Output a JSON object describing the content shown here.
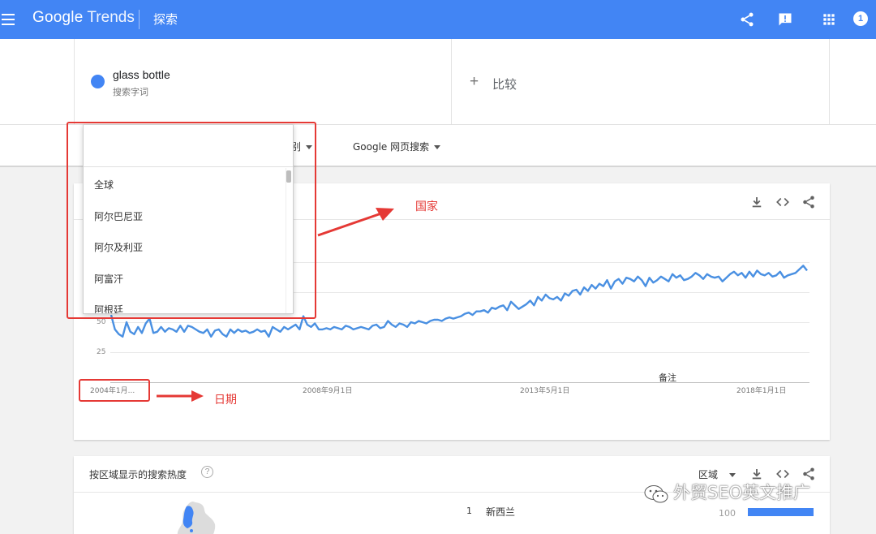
{
  "header": {
    "logo_google": "Google",
    "logo_trends": "Trends",
    "section": "探索",
    "icons": [
      "menu-icon",
      "share-icon",
      "feedback-icon",
      "apps-icon"
    ],
    "account_badge": "1",
    "color": "#4285f4"
  },
  "search_term": {
    "name": "glass bottle",
    "type": "搜索字词",
    "color": "#4285f4"
  },
  "compare": {
    "plus": "+",
    "label": "比较"
  },
  "filters": {
    "category_partial": "别",
    "search_type": "Google 网页搜索"
  },
  "country_dropdown": {
    "search_value": "",
    "items": [
      "全球",
      "阿尔巴尼亚",
      "阿尔及利亚",
      "阿富汗",
      "阿根廷"
    ]
  },
  "interest_chart": {
    "toolbar_icons": [
      "download-icon",
      "embed-icon",
      "share-icon"
    ],
    "note_label": "备注"
  },
  "chart_data": {
    "type": "line",
    "x_tick_labels": [
      "2004年1月...",
      "2008年9月1日",
      "2013年5月1日",
      "2018年1月1日"
    ],
    "y_ticks_visible": [
      "50",
      "25"
    ],
    "ylim": [
      0,
      100
    ],
    "grid": true,
    "series": [
      {
        "color": "#4a90e2",
        "values": [
          56,
          44,
          40,
          38,
          50,
          42,
          40,
          46,
          41,
          49,
          53,
          41,
          42,
          46,
          42,
          45,
          44,
          42,
          47,
          42,
          47,
          46,
          44,
          42,
          41,
          44,
          38,
          43,
          44,
          40,
          38,
          44,
          41,
          44,
          42,
          43,
          41,
          42,
          44,
          42,
          43,
          38,
          46,
          44,
          42,
          46,
          44,
          46,
          48,
          44,
          55,
          48,
          46,
          49,
          44,
          44,
          45,
          44,
          46,
          45,
          44,
          47,
          46,
          44,
          45,
          46,
          45,
          44,
          47,
          48,
          45,
          46,
          51,
          48,
          46,
          49,
          48,
          46,
          50,
          49,
          51,
          50,
          49,
          51,
          52,
          52,
          51,
          53,
          54,
          53,
          54,
          55,
          57,
          58,
          56,
          59,
          59,
          60,
          58,
          62,
          61,
          63,
          64,
          60,
          67,
          64,
          61,
          63,
          65,
          68,
          64,
          71,
          68,
          73,
          70,
          69,
          71,
          68,
          74,
          72,
          76,
          77,
          73,
          79,
          76,
          81,
          78,
          82,
          80,
          85,
          78,
          84,
          86,
          82,
          87,
          86,
          84,
          88,
          85,
          80,
          87,
          83,
          85,
          88,
          86,
          84,
          90,
          87,
          89,
          85,
          86,
          88,
          91,
          89,
          86,
          90,
          88,
          87,
          88,
          84,
          87,
          90,
          92,
          89,
          91,
          87,
          92,
          88,
          93,
          90,
          89,
          91,
          88,
          89,
          92,
          87,
          89,
          90,
          91,
          94,
          97,
          93
        ]
      }
    ]
  },
  "region_section": {
    "title": "按区域显示的搜索热度",
    "help": "?",
    "granularity": "区域",
    "toolbar_icons": [
      "download-icon",
      "embed-icon",
      "share-icon"
    ],
    "rows": [
      {
        "rank": "1",
        "name": "新西兰",
        "value": 100
      }
    ],
    "bar_color": "#4285f4"
  },
  "annotations": {
    "country_label": "国家",
    "date_label": "日期",
    "color": "#e53935"
  },
  "watermark": {
    "text": "外贸SEO英文推广"
  }
}
